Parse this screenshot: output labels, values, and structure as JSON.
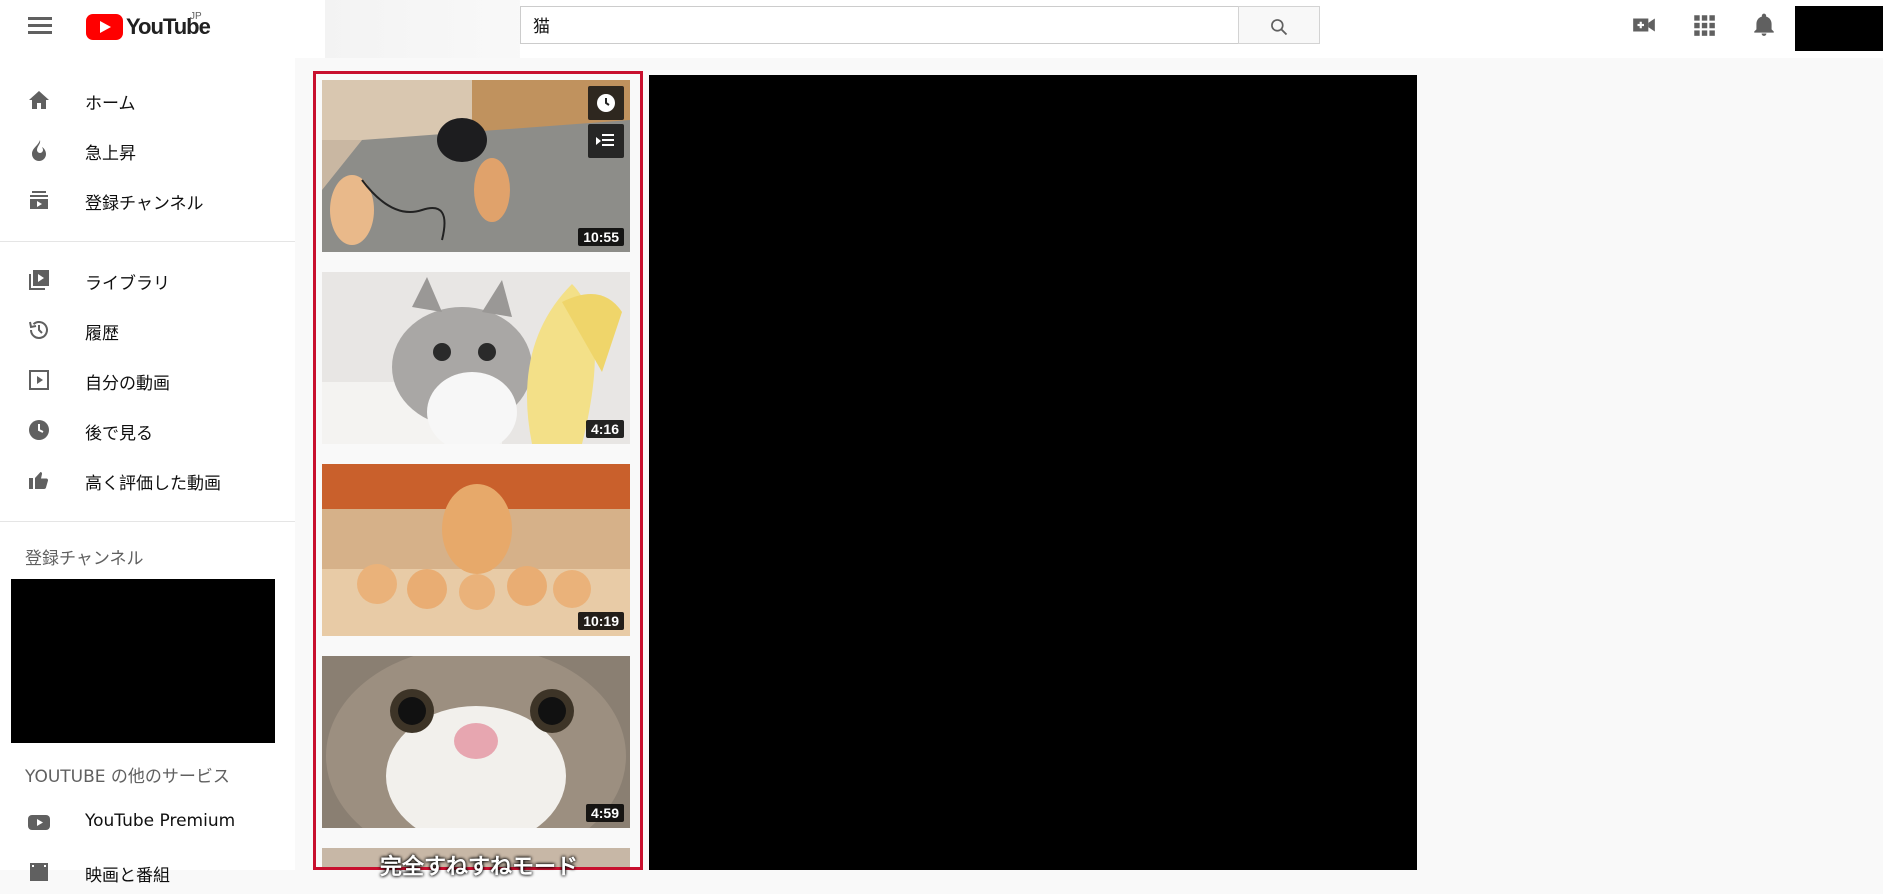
{
  "header": {
    "logo_text": "YouTube",
    "region": "JP",
    "search_value": "猫"
  },
  "sidebar": {
    "items_primary": [
      {
        "label": "ホーム",
        "icon": "home-icon"
      },
      {
        "label": "急上昇",
        "icon": "trending-icon"
      },
      {
        "label": "登録チャンネル",
        "icon": "subscriptions-icon"
      }
    ],
    "items_secondary": [
      {
        "label": "ライブラリ",
        "icon": "library-icon"
      },
      {
        "label": "履歴",
        "icon": "history-icon"
      },
      {
        "label": "自分の動画",
        "icon": "your-videos-icon"
      },
      {
        "label": "後で見る",
        "icon": "watch-later-icon"
      },
      {
        "label": "高く評価した動画",
        "icon": "liked-icon"
      }
    ],
    "subscriptions_title": "登録チャンネル",
    "more_services_title": "YOUTUBE の他のサービス",
    "more_items": [
      {
        "label": "YouTube Premium",
        "icon": "youtube-premium-icon"
      },
      {
        "label": "映画と番組",
        "icon": "movies-icon"
      }
    ]
  },
  "playlist": {
    "videos": [
      {
        "duration": "10:55"
      },
      {
        "duration": "4:16"
      },
      {
        "duration": "10:19"
      },
      {
        "duration": "4:59"
      }
    ],
    "partial_caption": "完全すねすねモード"
  },
  "colors": {
    "accent": "#ff0000",
    "highlight_border": "#c8102e"
  }
}
